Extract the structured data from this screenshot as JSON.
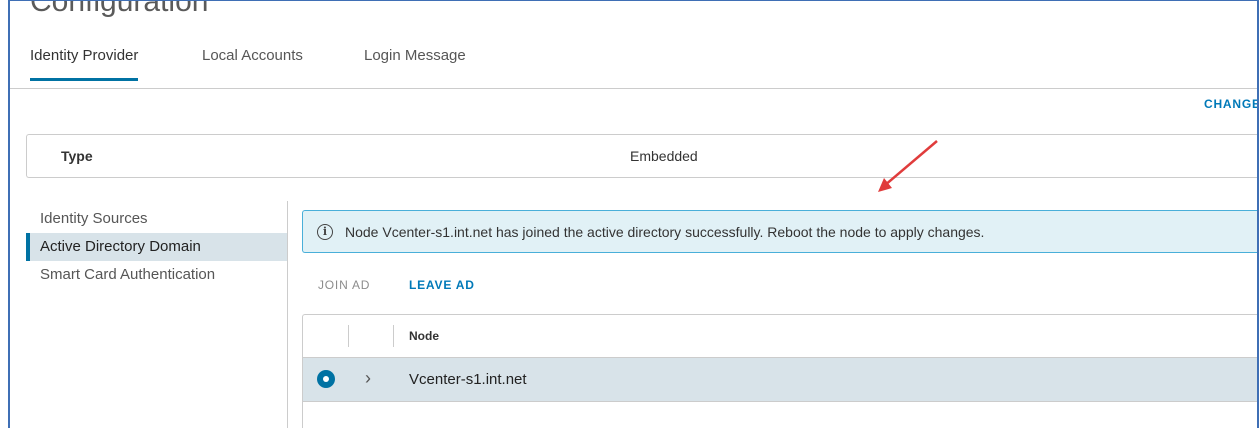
{
  "page": {
    "title": "Configuration"
  },
  "tabs": [
    {
      "label": "Identity Provider",
      "active": true
    },
    {
      "label": "Local Accounts",
      "active": false
    },
    {
      "label": "Login Message",
      "active": false
    }
  ],
  "toolbar": {
    "change_label": "CHANGE"
  },
  "type_row": {
    "label": "Type",
    "value": "Embedded"
  },
  "side_nav": {
    "items": [
      {
        "label": "Identity Sources",
        "active": false
      },
      {
        "label": "Active Directory Domain",
        "active": true
      },
      {
        "label": "Smart Card Authentication",
        "active": false
      }
    ]
  },
  "alert": {
    "icon": "info-icon",
    "message": "Node Vcenter-s1.int.net has joined the active directory successfully. Reboot the node to apply changes.",
    "color": "#e1f1f6"
  },
  "actions": {
    "join_ad": "JOIN AD",
    "leave_ad": "LEAVE AD"
  },
  "grid": {
    "columns": [
      "Node"
    ],
    "rows": [
      {
        "node": "Vcenter-s1.int.net",
        "selected": true
      }
    ]
  },
  "colors": {
    "accent": "#0072a3",
    "link": "#0079b8",
    "annotation_arrow": "#e03c3c"
  }
}
